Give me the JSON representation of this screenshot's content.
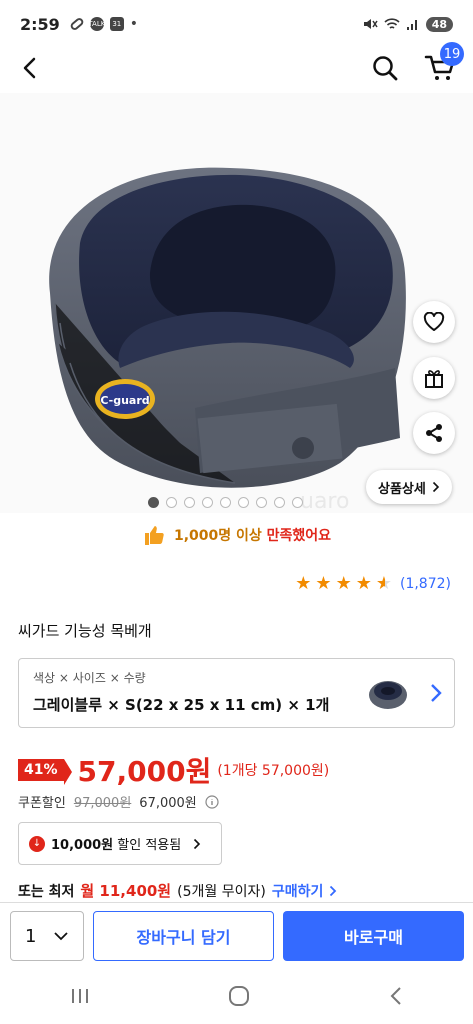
{
  "status_bar": {
    "time": "2:59",
    "left_badges": [
      "TALK",
      "31"
    ],
    "battery": "48",
    "icons": [
      "link-icon",
      "talk-icon",
      "calendar-icon",
      "dot-icon",
      "mute-icon",
      "wifi-icon",
      "signal-icon",
      "battery-icon"
    ]
  },
  "header": {
    "cart_count": "19",
    "icons": [
      "back-icon",
      "search-icon",
      "cart-icon"
    ]
  },
  "gallery": {
    "total_images": 9,
    "active_index": 0,
    "logo_text": "C-guard",
    "detail_button": "상품상세",
    "side_buttons": [
      "heart-icon",
      "gift-icon",
      "share-icon"
    ]
  },
  "satisfaction": {
    "count": "1,000명 이상",
    "text": "만족했어요"
  },
  "rating": {
    "stars": 4.5,
    "count": "(1,872)"
  },
  "product": {
    "title": "씨가드 기능성 목베개"
  },
  "option": {
    "label": "색상 × 사이즈 × 수량",
    "value": "그레이블루 × S(22 x 25 x 11 cm) × 1개"
  },
  "price": {
    "discount": "41%",
    "main": "57,000원",
    "unit": "(1개당 57,000원)"
  },
  "coupon": {
    "label": "쿠폰할인",
    "original": "97,000원",
    "sale": "67,000원"
  },
  "discount_applied": {
    "amount": "10,000원",
    "text": "할인 적용됨"
  },
  "installment": {
    "prefix": "또는 최저",
    "amount": "월 11,400원",
    "months": "(5개월 무이자)",
    "link": "구매하기"
  },
  "buy_bar": {
    "quantity": "1",
    "cart_button": "장바구니 담기",
    "buy_button": "바로구매"
  },
  "colors": {
    "accent": "#346aff",
    "price_red": "#e0261a",
    "star_orange": "#f28b00"
  }
}
